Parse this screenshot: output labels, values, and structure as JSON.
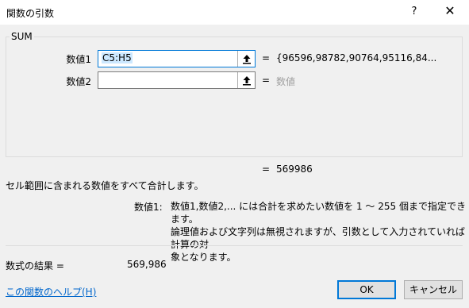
{
  "window": {
    "title": "関数の引数",
    "help_glyph": "?",
    "close_glyph": "✕"
  },
  "function_group": {
    "name": "SUM",
    "args": [
      {
        "label": "数値1",
        "value": "C5:H5",
        "equals": "=",
        "result": "{96596,98782,90764,95116,84..."
      },
      {
        "label": "数値2",
        "value": "",
        "equals": "=",
        "result": "数値"
      }
    ]
  },
  "total_result": {
    "equals": "=",
    "value": "569986"
  },
  "description": "セル範囲に含まれる数値をすべて合計します。",
  "arg_description": {
    "label": "数値1:",
    "lines": [
      "数値1,数値2,... には合計を求めたい数値を 1 ～ 255 個まで指定できます。",
      "論理値および文字列は無視されますが、引数として入力されていれば計算の対",
      "象となります。"
    ]
  },
  "formula_result": {
    "label": "数式の結果 =",
    "value": "569,986"
  },
  "help_link": "この関数のヘルプ(H)",
  "buttons": {
    "ok": "OK",
    "cancel": "キャンセル"
  }
}
